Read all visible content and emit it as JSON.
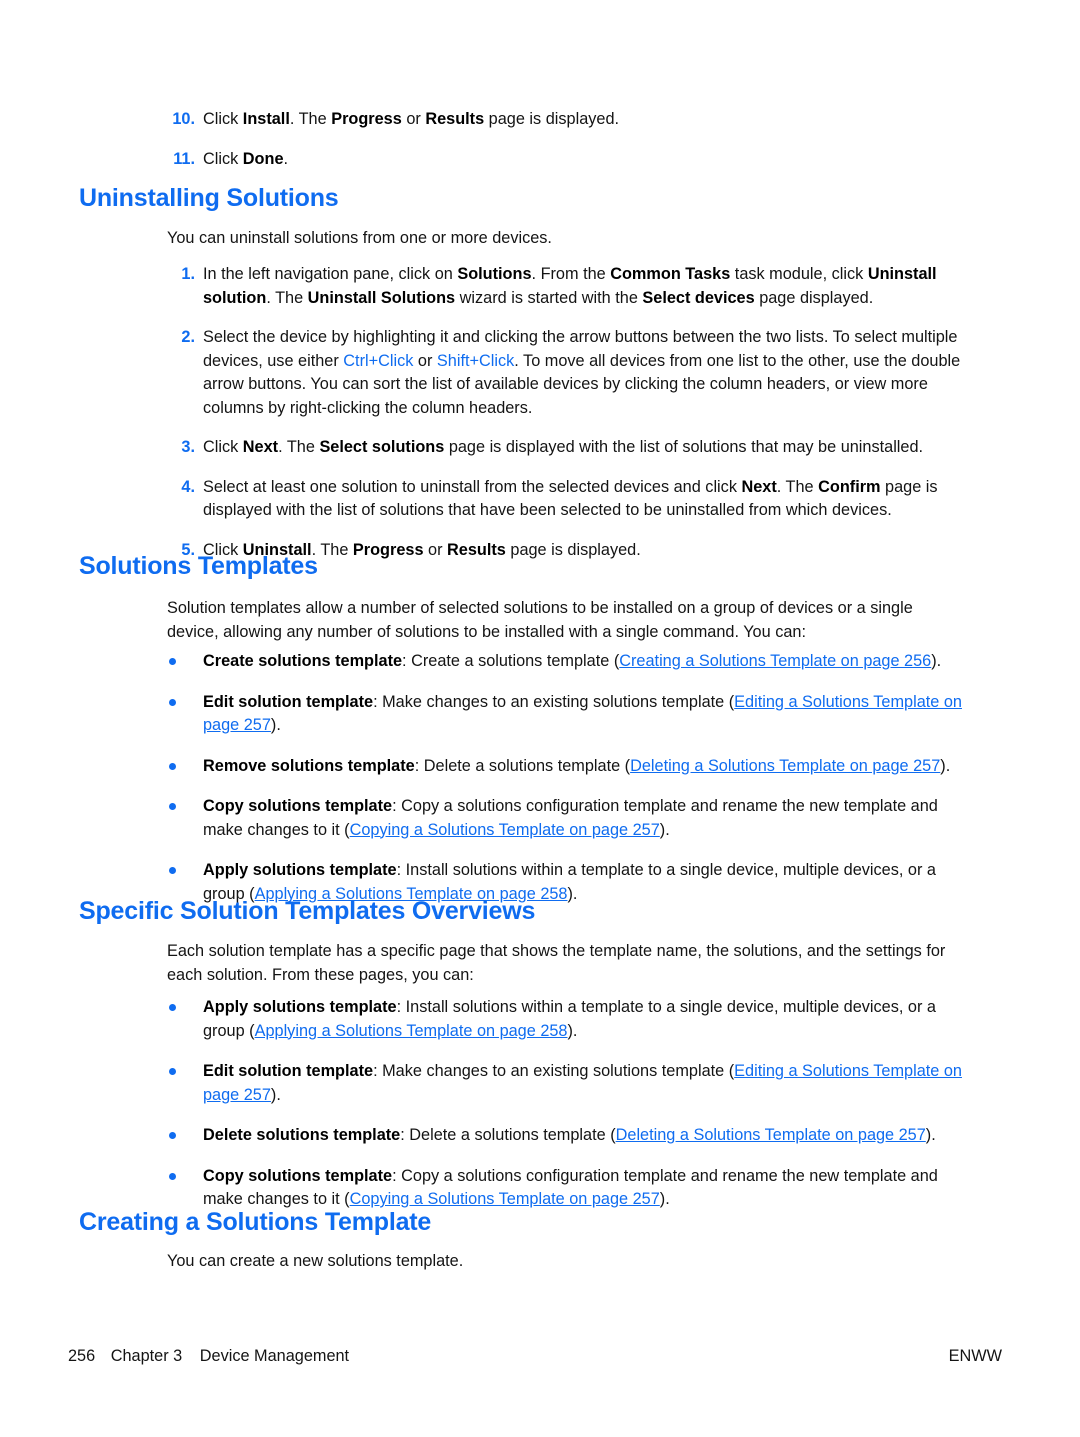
{
  "document": {
    "page_number": "256",
    "chapter": "Chapter 3",
    "chapter_title": "Device Management",
    "footer_right": "ENWW",
    "accent_color": "#0f6cf0",
    "link_color": "#0f6cf0",
    "text_color": "#141414"
  },
  "steps_top": [
    {
      "number": "10.",
      "parts": [
        {
          "t": "Click ",
          "s": "plain"
        },
        {
          "t": "Install",
          "s": "bold"
        },
        {
          "t": ". The ",
          "s": "plain"
        },
        {
          "t": "Progress",
          "s": "bold"
        },
        {
          "t": " or ",
          "s": "plain"
        },
        {
          "t": "Results",
          "s": "bold"
        },
        {
          "t": " page is displayed.",
          "s": "plain"
        }
      ]
    },
    {
      "number": "11.",
      "parts": [
        {
          "t": "Click ",
          "s": "plain"
        },
        {
          "t": "Done",
          "s": "bold"
        },
        {
          "t": ".",
          "s": "plain"
        }
      ]
    }
  ],
  "section_uninstalling": {
    "heading": "Uninstalling Solutions",
    "intro": "You can uninstall solutions from one or more devices.",
    "steps": [
      {
        "number": "1.",
        "parts": [
          {
            "t": "In the left navigation pane, click on ",
            "s": "plain"
          },
          {
            "t": "Solutions",
            "s": "bold"
          },
          {
            "t": ". From the ",
            "s": "plain"
          },
          {
            "t": "Common Tasks",
            "s": "bold"
          },
          {
            "t": " task module, click ",
            "s": "plain"
          },
          {
            "t": "Uninstall solution",
            "s": "bold"
          },
          {
            "t": ". The ",
            "s": "plain"
          },
          {
            "t": "Uninstall Solutions",
            "s": "bold"
          },
          {
            "t": " wizard is started with the ",
            "s": "plain"
          },
          {
            "t": "Select devices",
            "s": "bold"
          },
          {
            "t": " page displayed.",
            "s": "plain"
          }
        ]
      },
      {
        "number": "2.",
        "parts": [
          {
            "t": "Select the device by highlighting it and clicking the arrow buttons between the two lists. To select multiple devices, use either ",
            "s": "plain"
          },
          {
            "t": "Ctrl+Click",
            "s": "keylink"
          },
          {
            "t": " or ",
            "s": "plain"
          },
          {
            "t": "Shift+Click",
            "s": "keylink"
          },
          {
            "t": ". To move all devices from one list to the other, use the double arrow buttons. You can sort the list of available devices by clicking the column headers, or view more columns by right-clicking the column headers.",
            "s": "plain"
          }
        ]
      },
      {
        "number": "3.",
        "parts": [
          {
            "t": "Click ",
            "s": "plain"
          },
          {
            "t": "Next",
            "s": "bold"
          },
          {
            "t": ". The ",
            "s": "plain"
          },
          {
            "t": "Select solutions",
            "s": "bold"
          },
          {
            "t": " page is displayed with the list of solutions that may be uninstalled.",
            "s": "plain"
          }
        ]
      },
      {
        "number": "4.",
        "parts": [
          {
            "t": "Select at least one solution to uninstall from the selected devices and click ",
            "s": "plain"
          },
          {
            "t": "Next",
            "s": "bold"
          },
          {
            "t": ". The ",
            "s": "plain"
          },
          {
            "t": "Confirm",
            "s": "bold"
          },
          {
            "t": " page is displayed with the list of solutions that have been selected to be uninstalled from which devices.",
            "s": "plain"
          }
        ]
      },
      {
        "number": "5.",
        "parts": [
          {
            "t": "Click ",
            "s": "plain"
          },
          {
            "t": "Uninstall",
            "s": "bold"
          },
          {
            "t": ". The ",
            "s": "plain"
          },
          {
            "t": "Progress",
            "s": "bold"
          },
          {
            "t": " or ",
            "s": "plain"
          },
          {
            "t": "Results",
            "s": "bold"
          },
          {
            "t": " page is displayed.",
            "s": "plain"
          }
        ]
      }
    ]
  },
  "section_solutions_templates": {
    "heading": "Solutions Templates",
    "intro": "Solution templates allow a number of selected solutions to be installed on a group of devices or a single device, allowing any number of solutions to be installed with a single command. You can:",
    "bullets": [
      {
        "parts": [
          {
            "t": "Create solutions template",
            "s": "bold"
          },
          {
            "t": ": Create a solutions template (",
            "s": "plain"
          },
          {
            "t": "Creating a Solutions Template on page 256",
            "s": "xref"
          },
          {
            "t": ").",
            "s": "plain"
          }
        ]
      },
      {
        "parts": [
          {
            "t": "Edit solution template",
            "s": "bold"
          },
          {
            "t": ": Make changes to an existing solutions template (",
            "s": "plain"
          },
          {
            "t": "Editing a Solutions Template on page 257",
            "s": "xref"
          },
          {
            "t": ").",
            "s": "plain"
          }
        ]
      },
      {
        "parts": [
          {
            "t": "Remove solutions template",
            "s": "bold"
          },
          {
            "t": ": Delete a solutions template (",
            "s": "plain"
          },
          {
            "t": "Deleting a Solutions Template on page 257",
            "s": "xref"
          },
          {
            "t": ").",
            "s": "plain"
          }
        ]
      },
      {
        "parts": [
          {
            "t": "Copy solutions template",
            "s": "bold"
          },
          {
            "t": ": Copy a solutions configuration template and rename the new template and make changes to it (",
            "s": "plain"
          },
          {
            "t": "Copying a Solutions Template on page 257",
            "s": "xref"
          },
          {
            "t": ").",
            "s": "plain"
          }
        ]
      },
      {
        "parts": [
          {
            "t": "Apply solutions template",
            "s": "bold"
          },
          {
            "t": ": Install solutions within a template to a single device, multiple devices, or a group (",
            "s": "plain"
          },
          {
            "t": "Applying a Solutions Template on page 258",
            "s": "xref"
          },
          {
            "t": ").",
            "s": "plain"
          }
        ]
      }
    ]
  },
  "section_specific_overviews": {
    "heading": "Specific Solution Templates Overviews",
    "intro": "Each solution template has a specific page that shows the template name, the solutions, and the settings for each solution. From these pages, you can:",
    "bullets": [
      {
        "parts": [
          {
            "t": "Apply solutions template",
            "s": "bold"
          },
          {
            "t": ": Install solutions within a template to a single device, multiple devices, or a group (",
            "s": "plain"
          },
          {
            "t": "Applying a Solutions Template on page 258",
            "s": "xref"
          },
          {
            "t": ").",
            "s": "plain"
          }
        ]
      },
      {
        "parts": [
          {
            "t": "Edit solution template",
            "s": "bold"
          },
          {
            "t": ": Make changes to an existing solutions template (",
            "s": "plain"
          },
          {
            "t": "Editing a Solutions Template on page 257",
            "s": "xref"
          },
          {
            "t": ").",
            "s": "plain"
          }
        ]
      },
      {
        "parts": [
          {
            "t": "Delete solutions template",
            "s": "bold"
          },
          {
            "t": ": Delete a solutions template (",
            "s": "plain"
          },
          {
            "t": "Deleting a Solutions Template on page 257",
            "s": "xref"
          },
          {
            "t": ").",
            "s": "plain"
          }
        ]
      },
      {
        "parts": [
          {
            "t": "Copy solutions template",
            "s": "bold"
          },
          {
            "t": ": Copy a solutions configuration template and rename the new template and make changes to it (",
            "s": "plain"
          },
          {
            "t": "Copying a Solutions Template on page 257",
            "s": "xref"
          },
          {
            "t": ").",
            "s": "plain"
          }
        ]
      }
    ]
  },
  "section_creating": {
    "heading": "Creating a Solutions Template",
    "intro": "You can create a new solutions template."
  }
}
